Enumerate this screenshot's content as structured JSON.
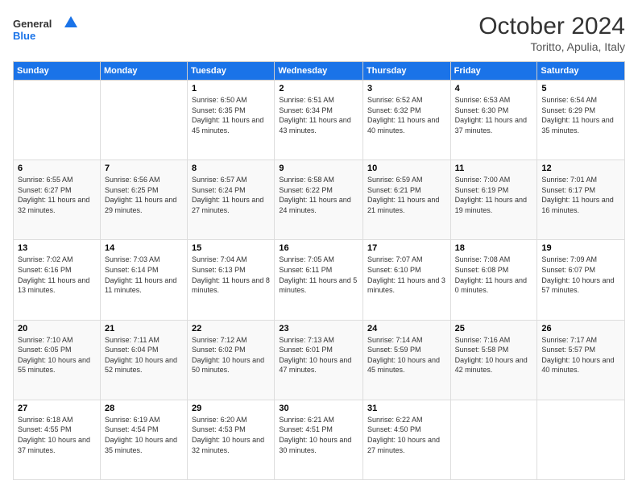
{
  "header": {
    "logo_general": "General",
    "logo_blue": "Blue",
    "month_title": "October 2024",
    "location": "Toritto, Apulia, Italy"
  },
  "days_of_week": [
    "Sunday",
    "Monday",
    "Tuesday",
    "Wednesday",
    "Thursday",
    "Friday",
    "Saturday"
  ],
  "weeks": [
    [
      {
        "day": "",
        "info": ""
      },
      {
        "day": "",
        "info": ""
      },
      {
        "day": "1",
        "info": "Sunrise: 6:50 AM\nSunset: 6:35 PM\nDaylight: 11 hours and 45 minutes."
      },
      {
        "day": "2",
        "info": "Sunrise: 6:51 AM\nSunset: 6:34 PM\nDaylight: 11 hours and 43 minutes."
      },
      {
        "day": "3",
        "info": "Sunrise: 6:52 AM\nSunset: 6:32 PM\nDaylight: 11 hours and 40 minutes."
      },
      {
        "day": "4",
        "info": "Sunrise: 6:53 AM\nSunset: 6:30 PM\nDaylight: 11 hours and 37 minutes."
      },
      {
        "day": "5",
        "info": "Sunrise: 6:54 AM\nSunset: 6:29 PM\nDaylight: 11 hours and 35 minutes."
      }
    ],
    [
      {
        "day": "6",
        "info": "Sunrise: 6:55 AM\nSunset: 6:27 PM\nDaylight: 11 hours and 32 minutes."
      },
      {
        "day": "7",
        "info": "Sunrise: 6:56 AM\nSunset: 6:25 PM\nDaylight: 11 hours and 29 minutes."
      },
      {
        "day": "8",
        "info": "Sunrise: 6:57 AM\nSunset: 6:24 PM\nDaylight: 11 hours and 27 minutes."
      },
      {
        "day": "9",
        "info": "Sunrise: 6:58 AM\nSunset: 6:22 PM\nDaylight: 11 hours and 24 minutes."
      },
      {
        "day": "10",
        "info": "Sunrise: 6:59 AM\nSunset: 6:21 PM\nDaylight: 11 hours and 21 minutes."
      },
      {
        "day": "11",
        "info": "Sunrise: 7:00 AM\nSunset: 6:19 PM\nDaylight: 11 hours and 19 minutes."
      },
      {
        "day": "12",
        "info": "Sunrise: 7:01 AM\nSunset: 6:17 PM\nDaylight: 11 hours and 16 minutes."
      }
    ],
    [
      {
        "day": "13",
        "info": "Sunrise: 7:02 AM\nSunset: 6:16 PM\nDaylight: 11 hours and 13 minutes."
      },
      {
        "day": "14",
        "info": "Sunrise: 7:03 AM\nSunset: 6:14 PM\nDaylight: 11 hours and 11 minutes."
      },
      {
        "day": "15",
        "info": "Sunrise: 7:04 AM\nSunset: 6:13 PM\nDaylight: 11 hours and 8 minutes."
      },
      {
        "day": "16",
        "info": "Sunrise: 7:05 AM\nSunset: 6:11 PM\nDaylight: 11 hours and 5 minutes."
      },
      {
        "day": "17",
        "info": "Sunrise: 7:07 AM\nSunset: 6:10 PM\nDaylight: 11 hours and 3 minutes."
      },
      {
        "day": "18",
        "info": "Sunrise: 7:08 AM\nSunset: 6:08 PM\nDaylight: 11 hours and 0 minutes."
      },
      {
        "day": "19",
        "info": "Sunrise: 7:09 AM\nSunset: 6:07 PM\nDaylight: 10 hours and 57 minutes."
      }
    ],
    [
      {
        "day": "20",
        "info": "Sunrise: 7:10 AM\nSunset: 6:05 PM\nDaylight: 10 hours and 55 minutes."
      },
      {
        "day": "21",
        "info": "Sunrise: 7:11 AM\nSunset: 6:04 PM\nDaylight: 10 hours and 52 minutes."
      },
      {
        "day": "22",
        "info": "Sunrise: 7:12 AM\nSunset: 6:02 PM\nDaylight: 10 hours and 50 minutes."
      },
      {
        "day": "23",
        "info": "Sunrise: 7:13 AM\nSunset: 6:01 PM\nDaylight: 10 hours and 47 minutes."
      },
      {
        "day": "24",
        "info": "Sunrise: 7:14 AM\nSunset: 5:59 PM\nDaylight: 10 hours and 45 minutes."
      },
      {
        "day": "25",
        "info": "Sunrise: 7:16 AM\nSunset: 5:58 PM\nDaylight: 10 hours and 42 minutes."
      },
      {
        "day": "26",
        "info": "Sunrise: 7:17 AM\nSunset: 5:57 PM\nDaylight: 10 hours and 40 minutes."
      }
    ],
    [
      {
        "day": "27",
        "info": "Sunrise: 6:18 AM\nSunset: 4:55 PM\nDaylight: 10 hours and 37 minutes."
      },
      {
        "day": "28",
        "info": "Sunrise: 6:19 AM\nSunset: 4:54 PM\nDaylight: 10 hours and 35 minutes."
      },
      {
        "day": "29",
        "info": "Sunrise: 6:20 AM\nSunset: 4:53 PM\nDaylight: 10 hours and 32 minutes."
      },
      {
        "day": "30",
        "info": "Sunrise: 6:21 AM\nSunset: 4:51 PM\nDaylight: 10 hours and 30 minutes."
      },
      {
        "day": "31",
        "info": "Sunrise: 6:22 AM\nSunset: 4:50 PM\nDaylight: 10 hours and 27 minutes."
      },
      {
        "day": "",
        "info": ""
      },
      {
        "day": "",
        "info": ""
      }
    ]
  ]
}
